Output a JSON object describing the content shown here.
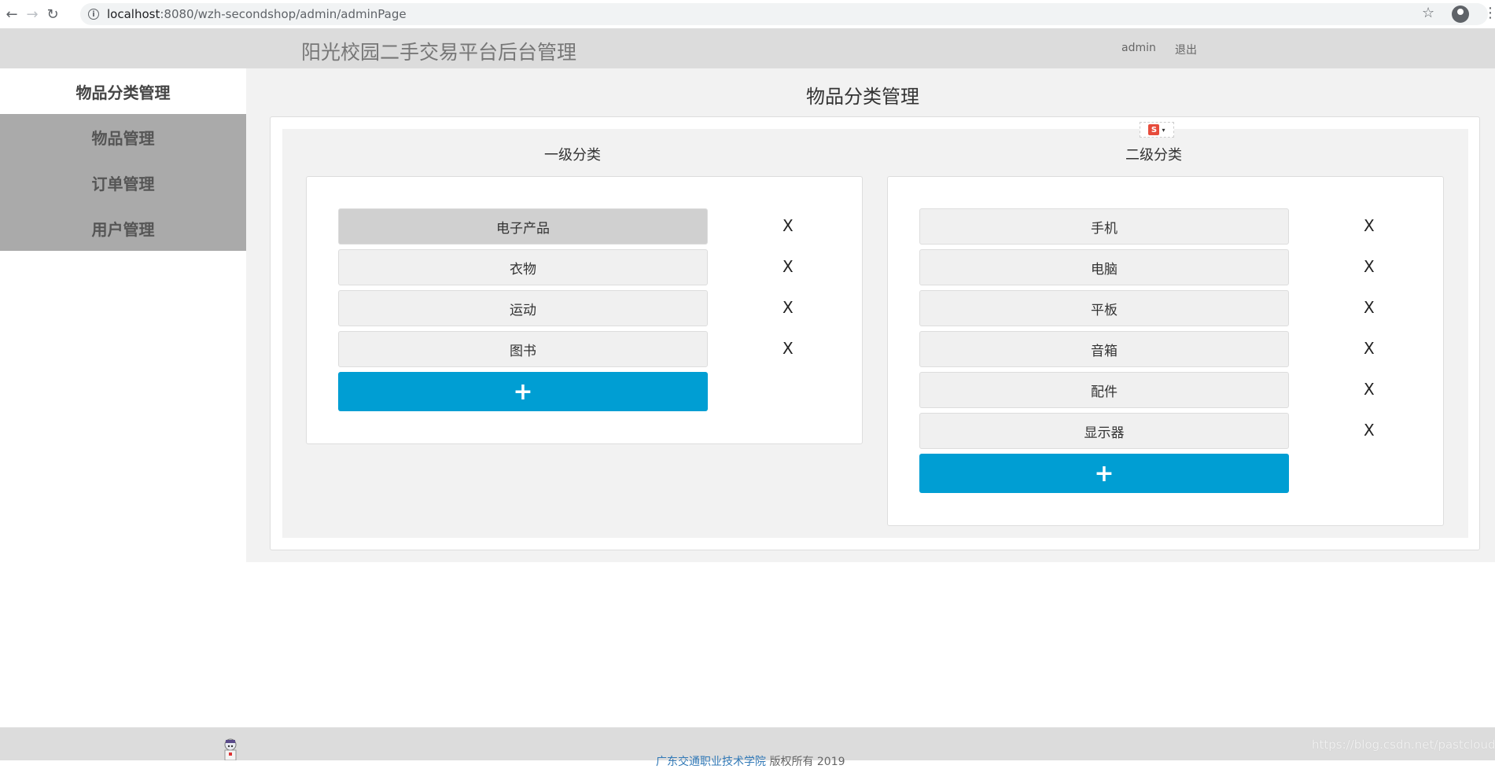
{
  "browser": {
    "url_host": "localhost",
    "url_path": ":8080/wzh-secondshop/admin/adminPage"
  },
  "header": {
    "title": "阳光校园二手交易平台后台管理",
    "admin_label": "admin",
    "logout_label": "退出"
  },
  "sidebar": {
    "active": "物品分类管理",
    "items": [
      {
        "label": "物品管理"
      },
      {
        "label": "订单管理"
      },
      {
        "label": "用户管理"
      }
    ]
  },
  "main": {
    "title": "物品分类管理",
    "primary": {
      "title": "一级分类",
      "items": [
        {
          "label": "电子产品",
          "delete": "X"
        },
        {
          "label": "衣物",
          "delete": "X"
        },
        {
          "label": "运动",
          "delete": "X"
        },
        {
          "label": "图书",
          "delete": "X"
        }
      ],
      "add_label": "+"
    },
    "secondary": {
      "title": "二级分类",
      "items": [
        {
          "label": "手机",
          "delete": "X"
        },
        {
          "label": "电脑",
          "delete": "X"
        },
        {
          "label": "平板",
          "delete": "X"
        },
        {
          "label": "音箱",
          "delete": "X"
        },
        {
          "label": "配件",
          "delete": "X"
        },
        {
          "label": "显示器",
          "delete": "X"
        }
      ],
      "add_label": "+"
    }
  },
  "ime": {
    "label": "S"
  },
  "footer": {
    "link_text": "广东交通职业技术学院",
    "copyright": " 版权所有 2019"
  },
  "watermark": "https://blog.csdn.net/pastclouds",
  "colors": {
    "accent": "#009ed3",
    "header_bg": "#dcdcdc",
    "sidebar_bg": "#aaaaaa"
  }
}
